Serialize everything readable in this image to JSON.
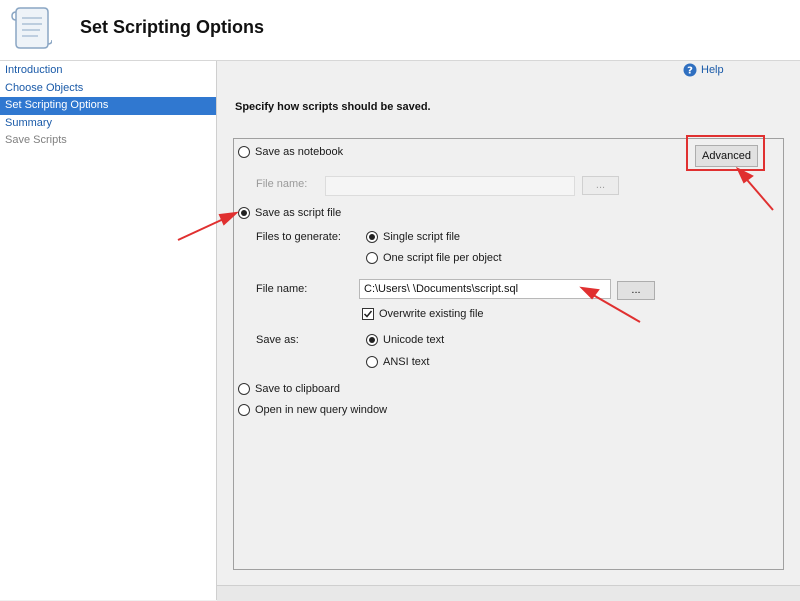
{
  "header": {
    "title": "Set Scripting Options",
    "logo_icon": "script-scroll-icon"
  },
  "sidebar": {
    "items": [
      {
        "label": "Introduction",
        "state": "link"
      },
      {
        "label": "Choose Objects",
        "state": "link"
      },
      {
        "label": "Set Scripting Options",
        "state": "selected"
      },
      {
        "label": "Summary",
        "state": "link"
      },
      {
        "label": "Save Scripts",
        "state": "disabled"
      }
    ]
  },
  "help": {
    "label": "Help",
    "icon": "help-icon"
  },
  "main": {
    "instruction": "Specify how scripts should be saved.",
    "advanced_label": "Advanced",
    "notebook": {
      "label": "Save as notebook",
      "file_name_label": "File name:",
      "file_name_value": "",
      "browse_label": "..."
    },
    "script_file": {
      "label": "Save as script file",
      "files_to_generate_label": "Files to generate:",
      "single_label": "Single script file",
      "per_object_label": "One script file per object",
      "file_name_label": "File name:",
      "file_name_value": "C:\\Users\\        \\Documents\\script.sql",
      "browse_label": "...",
      "overwrite_label": "Overwrite existing file",
      "save_as_label": "Save as:",
      "unicode_label": "Unicode text",
      "ansi_label": "ANSI text"
    },
    "clipboard_label": "Save to clipboard",
    "query_window_label": "Open in new query window"
  },
  "colors": {
    "selection": "#3078d0",
    "link": "#1a5aa8",
    "annotation": "#e03030"
  }
}
